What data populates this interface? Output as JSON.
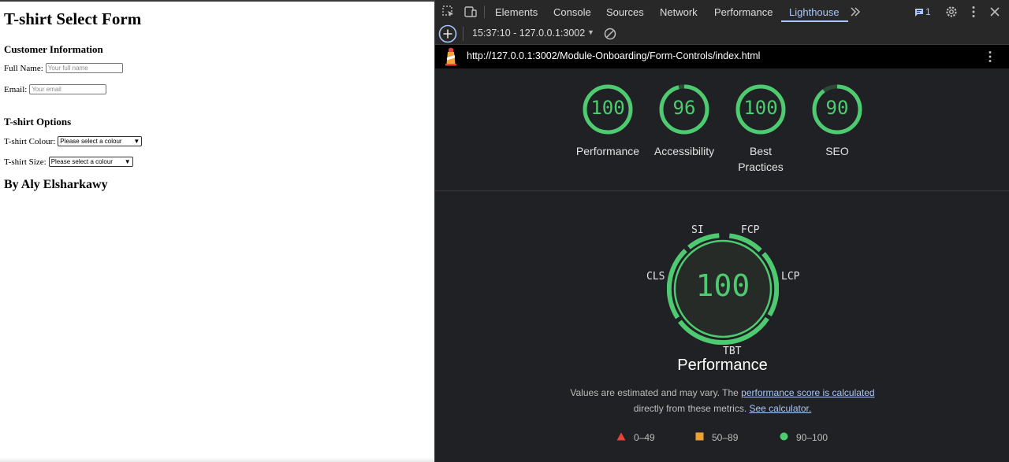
{
  "page": {
    "title": "T-shirt Select Form",
    "customer_section": "Customer Information",
    "full_name_label": "Full Name:",
    "full_name_placeholder": "Your full name",
    "email_label": "Email:",
    "email_placeholder": "Your email",
    "options_section": "T-shirt Options",
    "colour_label": "T-shirt Colour:",
    "colour_selected": "Please select a colour",
    "size_label": "T-shirt Size:",
    "size_selected": "Please select a colour",
    "author": "By Aly Elsharkawy"
  },
  "devtools": {
    "tabs": [
      "Elements",
      "Console",
      "Sources",
      "Network",
      "Performance",
      "Lighthouse"
    ],
    "active_tab": "Lighthouse",
    "issues_count": "1",
    "report_selector": "15:37:10 - 127.0.0.1:3002",
    "url": "http://127.0.0.1:3002/Module-Onboarding/Form-Controls/index.html",
    "icons": [
      "inspect-icon",
      "device-toolbar-icon",
      "more-tabs-icon",
      "issues-icon",
      "gear-icon",
      "kebab-menu-icon",
      "close-icon",
      "add-report-icon",
      "clear-icon",
      "lighthouse-logo-icon"
    ],
    "colors": {
      "pass": "#4ecb71",
      "average": "#f0a030",
      "fail": "#e8423a",
      "link": "#a8c7fa"
    }
  },
  "scores": [
    {
      "label": "Performance",
      "value": 100
    },
    {
      "label": "Accessibility",
      "value": 96
    },
    {
      "label": "Best Practices",
      "value": 100
    },
    {
      "label": "SEO",
      "value": 90
    }
  ],
  "performance": {
    "score": "100",
    "title": "Performance",
    "metrics": [
      "SI",
      "FCP",
      "LCP",
      "TBT",
      "CLS"
    ],
    "note_prefix": "Values are estimated and may vary. The ",
    "note_link": "performance score is calculated",
    "note_middle": "directly from these metrics. ",
    "note_link2": "See calculator.",
    "legend": [
      {
        "shape": "triangle",
        "range": "0–49"
      },
      {
        "shape": "square",
        "range": "50–89"
      },
      {
        "shape": "circle",
        "range": "90–100"
      }
    ]
  }
}
